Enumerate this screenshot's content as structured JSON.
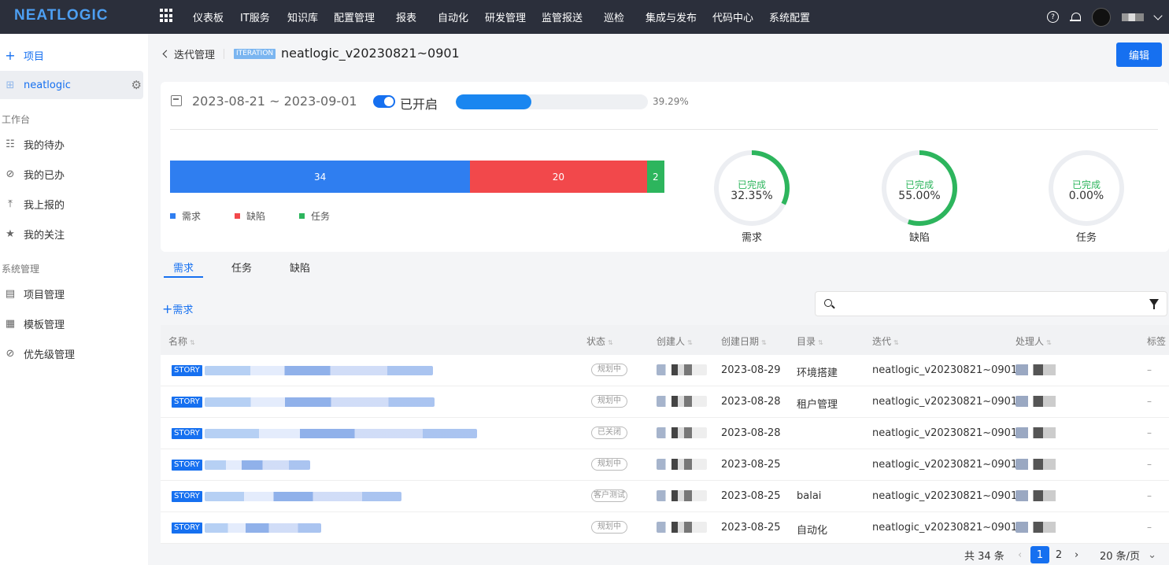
{
  "app": {
    "logo": "NEATLOGIC"
  },
  "topnav": {
    "menu": [
      "仪表板",
      "IT服务",
      "知识库",
      "配置管理",
      "报表",
      "自动化",
      "研发管理",
      "监管报送",
      "巡检",
      "集成与发布",
      "代码中心",
      "系统配置"
    ],
    "help_icon": "question-circle-icon",
    "bell_icon": "bell-icon"
  },
  "sidebar": {
    "add_project": "项目",
    "project": "neatlogic",
    "workbench_title": "工作台",
    "workbench": [
      {
        "label": "我的待办",
        "icon": "list-icon"
      },
      {
        "label": "我的已办",
        "icon": "check-circle-icon"
      },
      {
        "label": "我上报的",
        "icon": "upload-icon"
      },
      {
        "label": "我的关注",
        "icon": "star-icon"
      }
    ],
    "system_title": "系统管理",
    "system": [
      {
        "label": "项目管理",
        "icon": "project-icon"
      },
      {
        "label": "模板管理",
        "icon": "template-icon"
      },
      {
        "label": "优先级管理",
        "icon": "check-circle-icon"
      }
    ]
  },
  "header": {
    "back_label": "迭代管理",
    "badge": "ITERATION",
    "title": "neatlogic_v20230821~0901",
    "edit_label": "编辑"
  },
  "summary": {
    "date_range": "2023-08-21 ~ 2023-09-01",
    "toggle_label": "已开启",
    "progress": 39.29,
    "progress_text": "39.29%",
    "bar": [
      {
        "label": "需求",
        "value": 34,
        "color": "#2f7ef0"
      },
      {
        "label": "缺陷",
        "value": 20,
        "color": "#f2484b"
      },
      {
        "label": "任务",
        "value": 2,
        "color": "#2db55d"
      }
    ],
    "donuts": [
      {
        "done_label": "已完成",
        "pct_text": "32.35%",
        "pct": 32.35,
        "label": "需求"
      },
      {
        "done_label": "已完成",
        "pct_text": "55.00%",
        "pct": 55.0,
        "label": "缺陷"
      },
      {
        "done_label": "已完成",
        "pct_text": "0.00%",
        "pct": 0.0,
        "label": "任务"
      }
    ]
  },
  "tabs": [
    "需求",
    "任务",
    "缺陷"
  ],
  "add_story_label": "需求",
  "table": {
    "columns": [
      "名称",
      "状态",
      "创建人",
      "创建日期",
      "目录",
      "迭代",
      "处理人",
      "标签"
    ],
    "rows": [
      {
        "tag": "STORY",
        "status": "规划中",
        "date": "2023-08-29",
        "dir": "环境搭建",
        "iteration": "neatlogic_v20230821~0901",
        "label": "–"
      },
      {
        "tag": "STORY",
        "status": "规划中",
        "date": "2023-08-28",
        "dir": "租户管理",
        "iteration": "neatlogic_v20230821~0901",
        "label": "–"
      },
      {
        "tag": "STORY",
        "status": "已关闭",
        "date": "2023-08-28",
        "dir": "",
        "iteration": "neatlogic_v20230821~0901",
        "label": "–"
      },
      {
        "tag": "STORY",
        "status": "规划中",
        "date": "2023-08-25",
        "dir": "",
        "iteration": "neatlogic_v20230821~0901",
        "label": "–"
      },
      {
        "tag": "STORY",
        "status": "客户测试",
        "date": "2023-08-25",
        "dir": "balai",
        "iteration": "neatlogic_v20230821~0901",
        "label": "–"
      },
      {
        "tag": "STORY",
        "status": "规划中",
        "date": "2023-08-25",
        "dir": "自动化",
        "iteration": "neatlogic_v20230821~0901",
        "label": "–"
      }
    ]
  },
  "pagination": {
    "total": "共 34 条",
    "pages": [
      "1",
      "2"
    ],
    "page_size": "20 条/页"
  }
}
